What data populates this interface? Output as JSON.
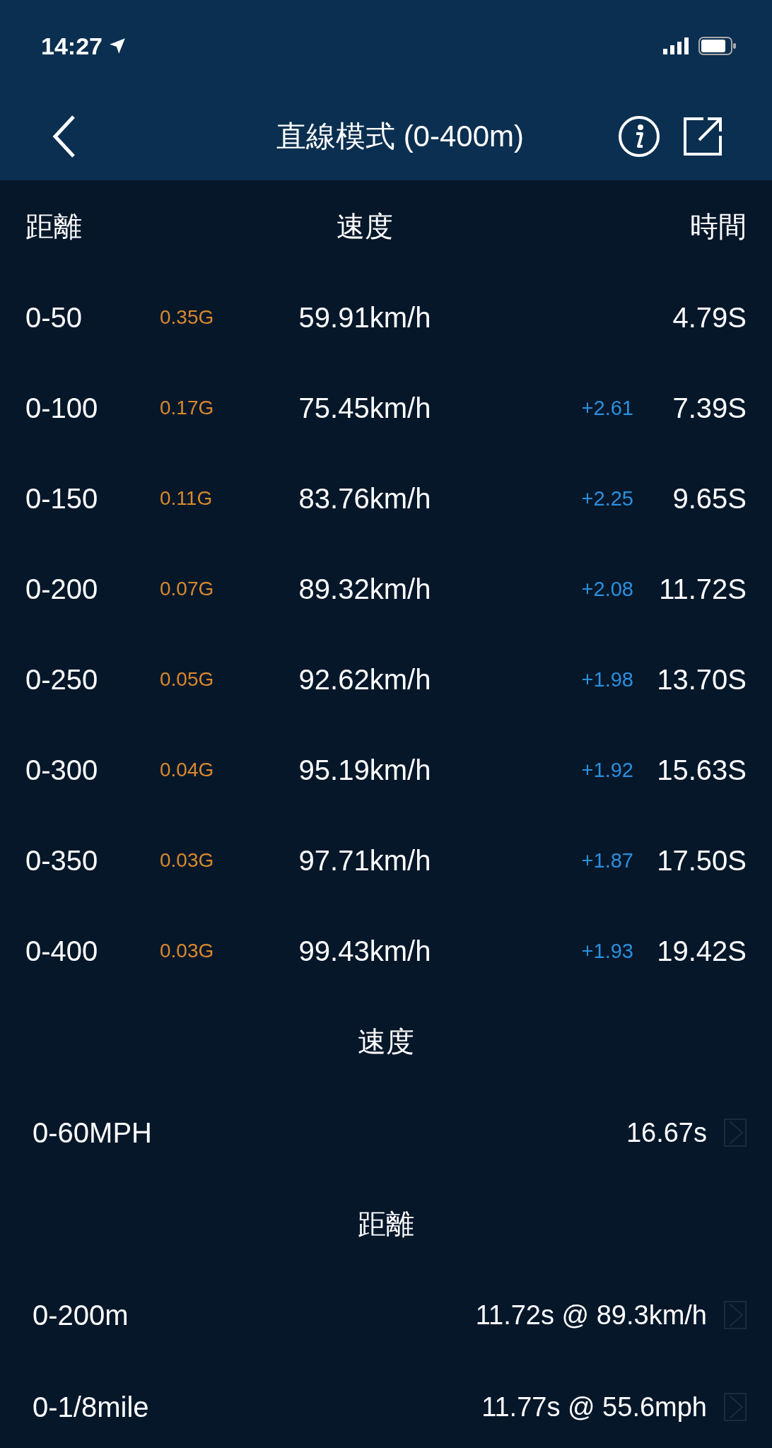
{
  "status_bar": {
    "time": "14:27"
  },
  "nav": {
    "title": "直線模式 (0-400m)"
  },
  "columns": [
    "距離",
    "速度",
    "時間"
  ],
  "rows": [
    {
      "distance": "0-50",
      "g": "0.35G",
      "speed": "59.91km/h",
      "time": "4.79S"
    },
    {
      "distance": "0-100",
      "g": "0.17G",
      "speed": "75.45km/h",
      "delta": "+2.61",
      "time": "7.39S"
    },
    {
      "distance": "0-150",
      "g": "0.11G",
      "speed": "83.76km/h",
      "delta": "+2.25",
      "time": "9.65S"
    },
    {
      "distance": "0-200",
      "g": "0.07G",
      "speed": "89.32km/h",
      "delta": "+2.08",
      "time": "11.72S"
    },
    {
      "distance": "0-250",
      "g": "0.05G",
      "speed": "92.62km/h",
      "delta": "+1.98",
      "time": "13.70S"
    },
    {
      "distance": "0-300",
      "g": "0.04G",
      "speed": "95.19km/h",
      "delta": "+1.92",
      "time": "15.63S"
    },
    {
      "distance": "0-350",
      "g": "0.03G",
      "speed": "97.71km/h",
      "delta": "+1.87",
      "time": "17.50S"
    },
    {
      "distance": "0-400",
      "g": "0.03G",
      "speed": "99.43km/h",
      "delta": "+1.93",
      "time": "19.42S"
    }
  ],
  "sections": [
    {
      "title": "速度",
      "items": [
        {
          "label": "0-60MPH",
          "value": "16.67s"
        }
      ]
    },
    {
      "title": "距離",
      "items": [
        {
          "label": "0-200m",
          "value": "11.72s @ 89.3km/h"
        },
        {
          "label": "0-1/8mile",
          "value": "11.77s @ 55.6mph"
        }
      ]
    }
  ]
}
